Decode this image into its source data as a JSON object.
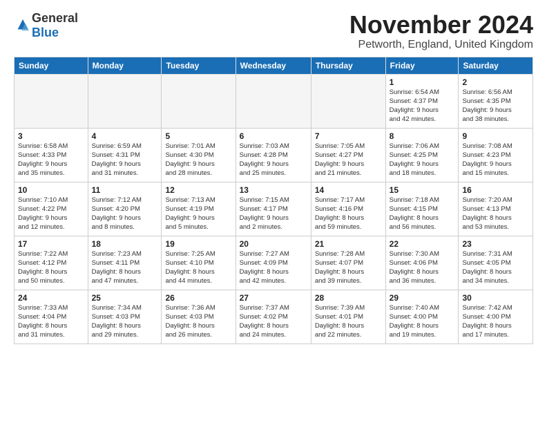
{
  "logo": {
    "general": "General",
    "blue": "Blue"
  },
  "header": {
    "month": "November 2024",
    "location": "Petworth, England, United Kingdom"
  },
  "weekdays": [
    "Sunday",
    "Monday",
    "Tuesday",
    "Wednesday",
    "Thursday",
    "Friday",
    "Saturday"
  ],
  "weeks": [
    [
      {
        "day": "",
        "info": ""
      },
      {
        "day": "",
        "info": ""
      },
      {
        "day": "",
        "info": ""
      },
      {
        "day": "",
        "info": ""
      },
      {
        "day": "",
        "info": ""
      },
      {
        "day": "1",
        "info": "Sunrise: 6:54 AM\nSunset: 4:37 PM\nDaylight: 9 hours\nand 42 minutes."
      },
      {
        "day": "2",
        "info": "Sunrise: 6:56 AM\nSunset: 4:35 PM\nDaylight: 9 hours\nand 38 minutes."
      }
    ],
    [
      {
        "day": "3",
        "info": "Sunrise: 6:58 AM\nSunset: 4:33 PM\nDaylight: 9 hours\nand 35 minutes."
      },
      {
        "day": "4",
        "info": "Sunrise: 6:59 AM\nSunset: 4:31 PM\nDaylight: 9 hours\nand 31 minutes."
      },
      {
        "day": "5",
        "info": "Sunrise: 7:01 AM\nSunset: 4:30 PM\nDaylight: 9 hours\nand 28 minutes."
      },
      {
        "day": "6",
        "info": "Sunrise: 7:03 AM\nSunset: 4:28 PM\nDaylight: 9 hours\nand 25 minutes."
      },
      {
        "day": "7",
        "info": "Sunrise: 7:05 AM\nSunset: 4:27 PM\nDaylight: 9 hours\nand 21 minutes."
      },
      {
        "day": "8",
        "info": "Sunrise: 7:06 AM\nSunset: 4:25 PM\nDaylight: 9 hours\nand 18 minutes."
      },
      {
        "day": "9",
        "info": "Sunrise: 7:08 AM\nSunset: 4:23 PM\nDaylight: 9 hours\nand 15 minutes."
      }
    ],
    [
      {
        "day": "10",
        "info": "Sunrise: 7:10 AM\nSunset: 4:22 PM\nDaylight: 9 hours\nand 12 minutes."
      },
      {
        "day": "11",
        "info": "Sunrise: 7:12 AM\nSunset: 4:20 PM\nDaylight: 9 hours\nand 8 minutes."
      },
      {
        "day": "12",
        "info": "Sunrise: 7:13 AM\nSunset: 4:19 PM\nDaylight: 9 hours\nand 5 minutes."
      },
      {
        "day": "13",
        "info": "Sunrise: 7:15 AM\nSunset: 4:17 PM\nDaylight: 9 hours\nand 2 minutes."
      },
      {
        "day": "14",
        "info": "Sunrise: 7:17 AM\nSunset: 4:16 PM\nDaylight: 8 hours\nand 59 minutes."
      },
      {
        "day": "15",
        "info": "Sunrise: 7:18 AM\nSunset: 4:15 PM\nDaylight: 8 hours\nand 56 minutes."
      },
      {
        "day": "16",
        "info": "Sunrise: 7:20 AM\nSunset: 4:13 PM\nDaylight: 8 hours\nand 53 minutes."
      }
    ],
    [
      {
        "day": "17",
        "info": "Sunrise: 7:22 AM\nSunset: 4:12 PM\nDaylight: 8 hours\nand 50 minutes."
      },
      {
        "day": "18",
        "info": "Sunrise: 7:23 AM\nSunset: 4:11 PM\nDaylight: 8 hours\nand 47 minutes."
      },
      {
        "day": "19",
        "info": "Sunrise: 7:25 AM\nSunset: 4:10 PM\nDaylight: 8 hours\nand 44 minutes."
      },
      {
        "day": "20",
        "info": "Sunrise: 7:27 AM\nSunset: 4:09 PM\nDaylight: 8 hours\nand 42 minutes."
      },
      {
        "day": "21",
        "info": "Sunrise: 7:28 AM\nSunset: 4:07 PM\nDaylight: 8 hours\nand 39 minutes."
      },
      {
        "day": "22",
        "info": "Sunrise: 7:30 AM\nSunset: 4:06 PM\nDaylight: 8 hours\nand 36 minutes."
      },
      {
        "day": "23",
        "info": "Sunrise: 7:31 AM\nSunset: 4:05 PM\nDaylight: 8 hours\nand 34 minutes."
      }
    ],
    [
      {
        "day": "24",
        "info": "Sunrise: 7:33 AM\nSunset: 4:04 PM\nDaylight: 8 hours\nand 31 minutes."
      },
      {
        "day": "25",
        "info": "Sunrise: 7:34 AM\nSunset: 4:03 PM\nDaylight: 8 hours\nand 29 minutes."
      },
      {
        "day": "26",
        "info": "Sunrise: 7:36 AM\nSunset: 4:03 PM\nDaylight: 8 hours\nand 26 minutes."
      },
      {
        "day": "27",
        "info": "Sunrise: 7:37 AM\nSunset: 4:02 PM\nDaylight: 8 hours\nand 24 minutes."
      },
      {
        "day": "28",
        "info": "Sunrise: 7:39 AM\nSunset: 4:01 PM\nDaylight: 8 hours\nand 22 minutes."
      },
      {
        "day": "29",
        "info": "Sunrise: 7:40 AM\nSunset: 4:00 PM\nDaylight: 8 hours\nand 19 minutes."
      },
      {
        "day": "30",
        "info": "Sunrise: 7:42 AM\nSunset: 4:00 PM\nDaylight: 8 hours\nand 17 minutes."
      }
    ]
  ]
}
